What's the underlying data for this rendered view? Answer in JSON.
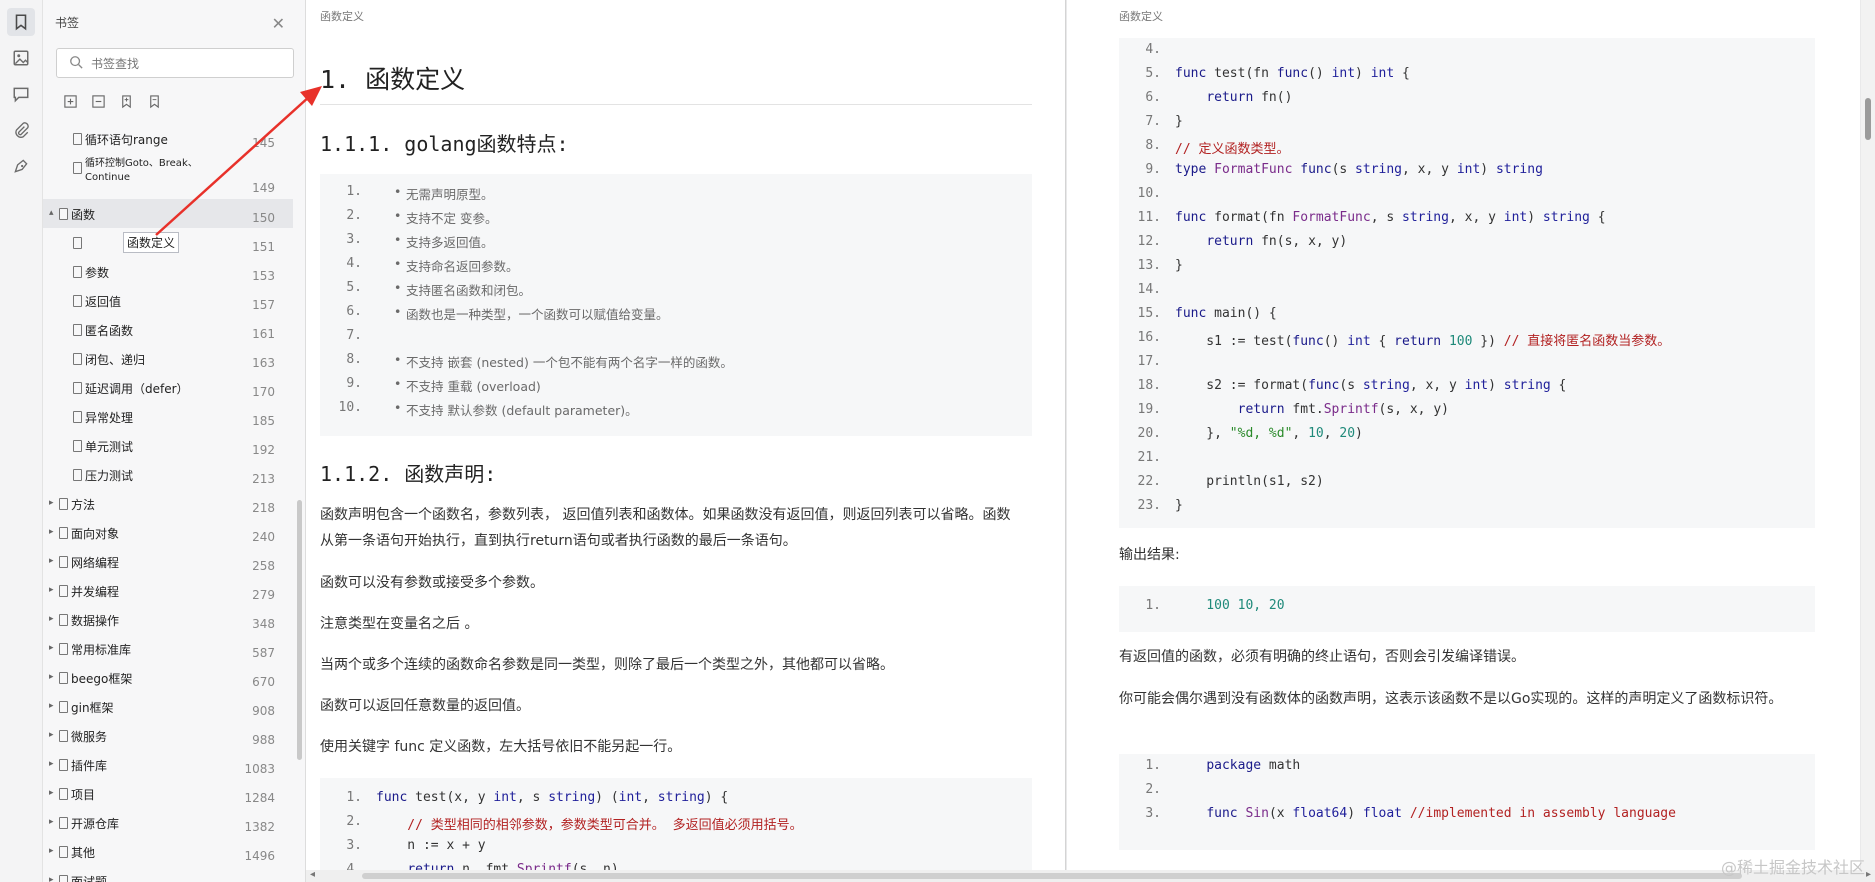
{
  "sidebar_rail": {
    "icons": [
      "bookmark-icon",
      "image-icon",
      "comment-icon",
      "attachment-icon",
      "signature-icon"
    ]
  },
  "bookmarks": {
    "title": "书签",
    "search_placeholder": "书签查找",
    "items": [
      {
        "label": "循环语句range",
        "page": "145",
        "level": 2,
        "twisty": ""
      },
      {
        "label": "循环控制Goto、Break、Continue",
        "page": "149",
        "level": 2,
        "twisty": ""
      },
      {
        "label": "函数",
        "page": "150",
        "level": 1,
        "twisty": "▴"
      },
      {
        "label": "函数定义",
        "page": "151",
        "level": 2,
        "twisty": ""
      },
      {
        "label": "参数",
        "page": "153",
        "level": 2,
        "twisty": ""
      },
      {
        "label": "返回值",
        "page": "157",
        "level": 2,
        "twisty": ""
      },
      {
        "label": "匿名函数",
        "page": "161",
        "level": 2,
        "twisty": ""
      },
      {
        "label": "闭包、递归",
        "page": "163",
        "level": 2,
        "twisty": ""
      },
      {
        "label": "延迟调用（defer）",
        "page": "170",
        "level": 2,
        "twisty": ""
      },
      {
        "label": "异常处理",
        "page": "185",
        "level": 2,
        "twisty": ""
      },
      {
        "label": "单元测试",
        "page": "192",
        "level": 2,
        "twisty": ""
      },
      {
        "label": "压力测试",
        "page": "213",
        "level": 2,
        "twisty": ""
      },
      {
        "label": "方法",
        "page": "218",
        "level": 1,
        "twisty": "▸"
      },
      {
        "label": "面向对象",
        "page": "240",
        "level": 1,
        "twisty": "▸"
      },
      {
        "label": "网络编程",
        "page": "258",
        "level": 1,
        "twisty": "▸"
      },
      {
        "label": "并发编程",
        "page": "279",
        "level": 1,
        "twisty": "▸"
      },
      {
        "label": "数据操作",
        "page": "348",
        "level": 1,
        "twisty": "▸"
      },
      {
        "label": "常用标准库",
        "page": "587",
        "level": 1,
        "twisty": "▸"
      },
      {
        "label": "beego框架",
        "page": "670",
        "level": 1,
        "twisty": "▸"
      },
      {
        "label": "gin框架",
        "page": "908",
        "level": 1,
        "twisty": "▸"
      },
      {
        "label": "微服务",
        "page": "988",
        "level": 1,
        "twisty": "▸"
      },
      {
        "label": "插件库",
        "page": "1083",
        "level": 1,
        "twisty": "▸"
      },
      {
        "label": "项目",
        "page": "1284",
        "level": 1,
        "twisty": "▸"
      },
      {
        "label": "开源仓库",
        "page": "1382",
        "level": 1,
        "twisty": "▸"
      },
      {
        "label": "其他",
        "page": "1496",
        "level": 1,
        "twisty": "▸"
      },
      {
        "label": "面试题",
        "page": "",
        "level": 1,
        "twisty": "▸"
      }
    ]
  },
  "left_page": {
    "header": "函数定义",
    "h1": "1. 函数定义",
    "h2_features": "1.1.1. golang函数特点:",
    "features": [
      {
        "n": "1.",
        "text": "无需声明原型。"
      },
      {
        "n": "2.",
        "text": "支持不定 变参。"
      },
      {
        "n": "3.",
        "text": "支持多返回值。"
      },
      {
        "n": "4.",
        "text": "支持命名返回参数。"
      },
      {
        "n": "5.",
        "text": "支持匿名函数和闭包。"
      },
      {
        "n": "6.",
        "text": "函数也是一种类型，一个函数可以赋值给变量。"
      },
      {
        "n": "7.",
        "text": ""
      },
      {
        "n": "8.",
        "text": "不支持 嵌套 (nested) 一个包不能有两个名字一样的函数。"
      },
      {
        "n": "9.",
        "text": "不支持 重载 (overload)"
      },
      {
        "n": "10.",
        "text": "不支持 默认参数 (default parameter)。"
      }
    ],
    "h2_decl": "1.1.2. 函数声明:",
    "paragraphs": [
      "函数声明包含一个函数名，参数列表， 返回值列表和函数体。如果函数没有返回值，则返回列表可以省略。函数从第一条语句开始执行，直到执行return语句或者执行函数的最后一条语句。",
      "函数可以没有参数或接受多个参数。",
      "注意类型在变量名之后 。",
      "当两个或多个连续的函数命名参数是同一类型，则除了最后一个类型之外，其他都可以省略。",
      "函数可以返回任意数量的返回值。",
      "使用关键字 func 定义函数，左大括号依旧不能另起一行。"
    ],
    "code_lines": [
      {
        "n": "1.",
        "html": "func test(x, y int, s string) (int, string) {"
      },
      {
        "n": "2.",
        "html": "    // 类型相同的相邻参数，参数类型可合并。 多返回值必须用括号。"
      },
      {
        "n": "3.",
        "html": "    n := x + y"
      },
      {
        "n": "4.",
        "html": "    return n, fmt.Sprintf(s, n)"
      }
    ]
  },
  "right_page": {
    "header": "函数定义",
    "code1": [
      {
        "n": "4.",
        "t": ""
      },
      {
        "n": "5.",
        "t": "func test(fn func() int) int {"
      },
      {
        "n": "6.",
        "t": "    return fn()"
      },
      {
        "n": "7.",
        "t": "}"
      },
      {
        "n": "8.",
        "t": "// 定义函数类型。"
      },
      {
        "n": "9.",
        "t": "type FormatFunc func(s string, x, y int) string"
      },
      {
        "n": "10.",
        "t": ""
      },
      {
        "n": "11.",
        "t": "func format(fn FormatFunc, s string, x, y int) string {"
      },
      {
        "n": "12.",
        "t": "    return fn(s, x, y)"
      },
      {
        "n": "13.",
        "t": "}"
      },
      {
        "n": "14.",
        "t": ""
      },
      {
        "n": "15.",
        "t": "func main() {"
      },
      {
        "n": "16.",
        "t": "    s1 := test(func() int { return 100 }) // 直接将匿名函数当参数。"
      },
      {
        "n": "17.",
        "t": ""
      },
      {
        "n": "18.",
        "t": "    s2 := format(func(s string, x, y int) string {"
      },
      {
        "n": "19.",
        "t": "        return fmt.Sprintf(s, x, y)"
      },
      {
        "n": "20.",
        "t": "    }, \"%d, %d\", 10, 20)"
      },
      {
        "n": "21.",
        "t": ""
      },
      {
        "n": "22.",
        "t": "    println(s1, s2)"
      },
      {
        "n": "23.",
        "t": "}"
      }
    ],
    "output_label": "输出结果:",
    "output_code": {
      "n": "1.",
      "t": "    100 10, 20"
    },
    "para1": "有返回值的函数，必须有明确的终止语句，否则会引发编译错误。",
    "para2": "你可能会偶尔遇到没有函数体的函数声明，这表示该函数不是以Go实现的。这样的声明定义了函数标识符。",
    "code2": [
      {
        "n": "1.",
        "t": "    package math"
      },
      {
        "n": "2.",
        "t": ""
      },
      {
        "n": "3.",
        "t": "    func Sin(x float64) float //implemented in assembly language"
      }
    ]
  },
  "watermark": "@稀土掘金技术社区",
  "colors": {
    "keyword": "#1a1a8a",
    "comment": "#b22222",
    "number": "#1f8a7a",
    "string": "#2a8a2a",
    "function": "#7a2b8a",
    "arrow": "#e8312a"
  }
}
